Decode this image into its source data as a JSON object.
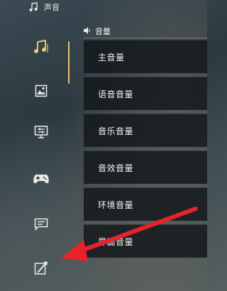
{
  "header": {
    "title": "声音",
    "icon": "music-note-icon"
  },
  "sidebar": {
    "items": [
      {
        "name": "audio",
        "icon": "music-note-icon",
        "selected": true
      },
      {
        "name": "display",
        "icon": "picture-icon"
      },
      {
        "name": "monitor",
        "icon": "monitor-settings-icon"
      },
      {
        "name": "controller",
        "icon": "gamepad-icon"
      },
      {
        "name": "chat",
        "icon": "chat-bubble-icon"
      },
      {
        "name": "tools",
        "icon": "wrench-icon"
      }
    ]
  },
  "volume_section": {
    "header": "音量",
    "icon": "speaker-icon",
    "rows": [
      {
        "label": "主音量"
      },
      {
        "label": "语音音量"
      },
      {
        "label": "音乐音量"
      },
      {
        "label": "音效音量"
      },
      {
        "label": "环境音量"
      },
      {
        "label": "界面音量"
      }
    ]
  },
  "colors": {
    "accent": "#e8c66a",
    "annotation_arrow": "#e8222a",
    "row_background": "#12161a"
  }
}
